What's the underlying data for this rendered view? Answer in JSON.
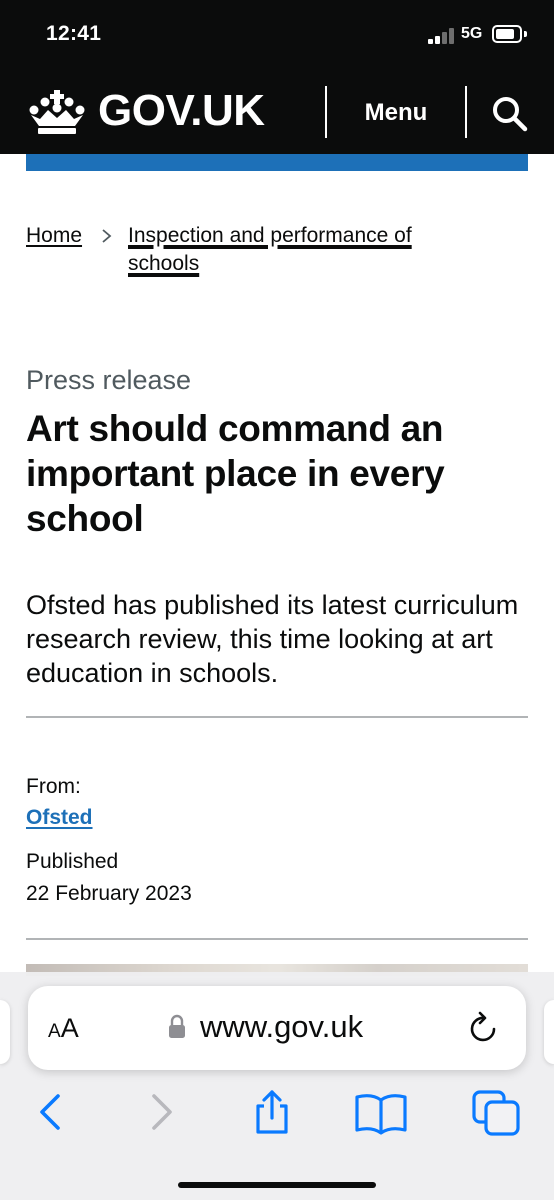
{
  "status_bar": {
    "time": "12:41",
    "network": "5G"
  },
  "header": {
    "logo_text": "GOV.UK",
    "menu_label": "Menu"
  },
  "breadcrumbs": [
    {
      "label": "Home"
    },
    {
      "label": "Inspection and performance of schools"
    }
  ],
  "article": {
    "caption": "Press release",
    "title": "Art should command an important place in every school",
    "lead": "Ofsted has published its latest curriculum research review, this time looking at art education in schools.",
    "from_label": "From:",
    "from_org": "Ofsted",
    "published_label": "Published",
    "published_date": "22 February 2023"
  },
  "browser": {
    "text_size_label_small": "A",
    "text_size_label_large": "A",
    "url": "www.gov.uk"
  },
  "colors": {
    "header_background": "#0b0c0c",
    "link_blue": "#1d70b8",
    "secondary_text": "#505a5f",
    "browser_icon_active": "#0a7aff",
    "browser_icon_disabled": "#b8b8bd"
  }
}
